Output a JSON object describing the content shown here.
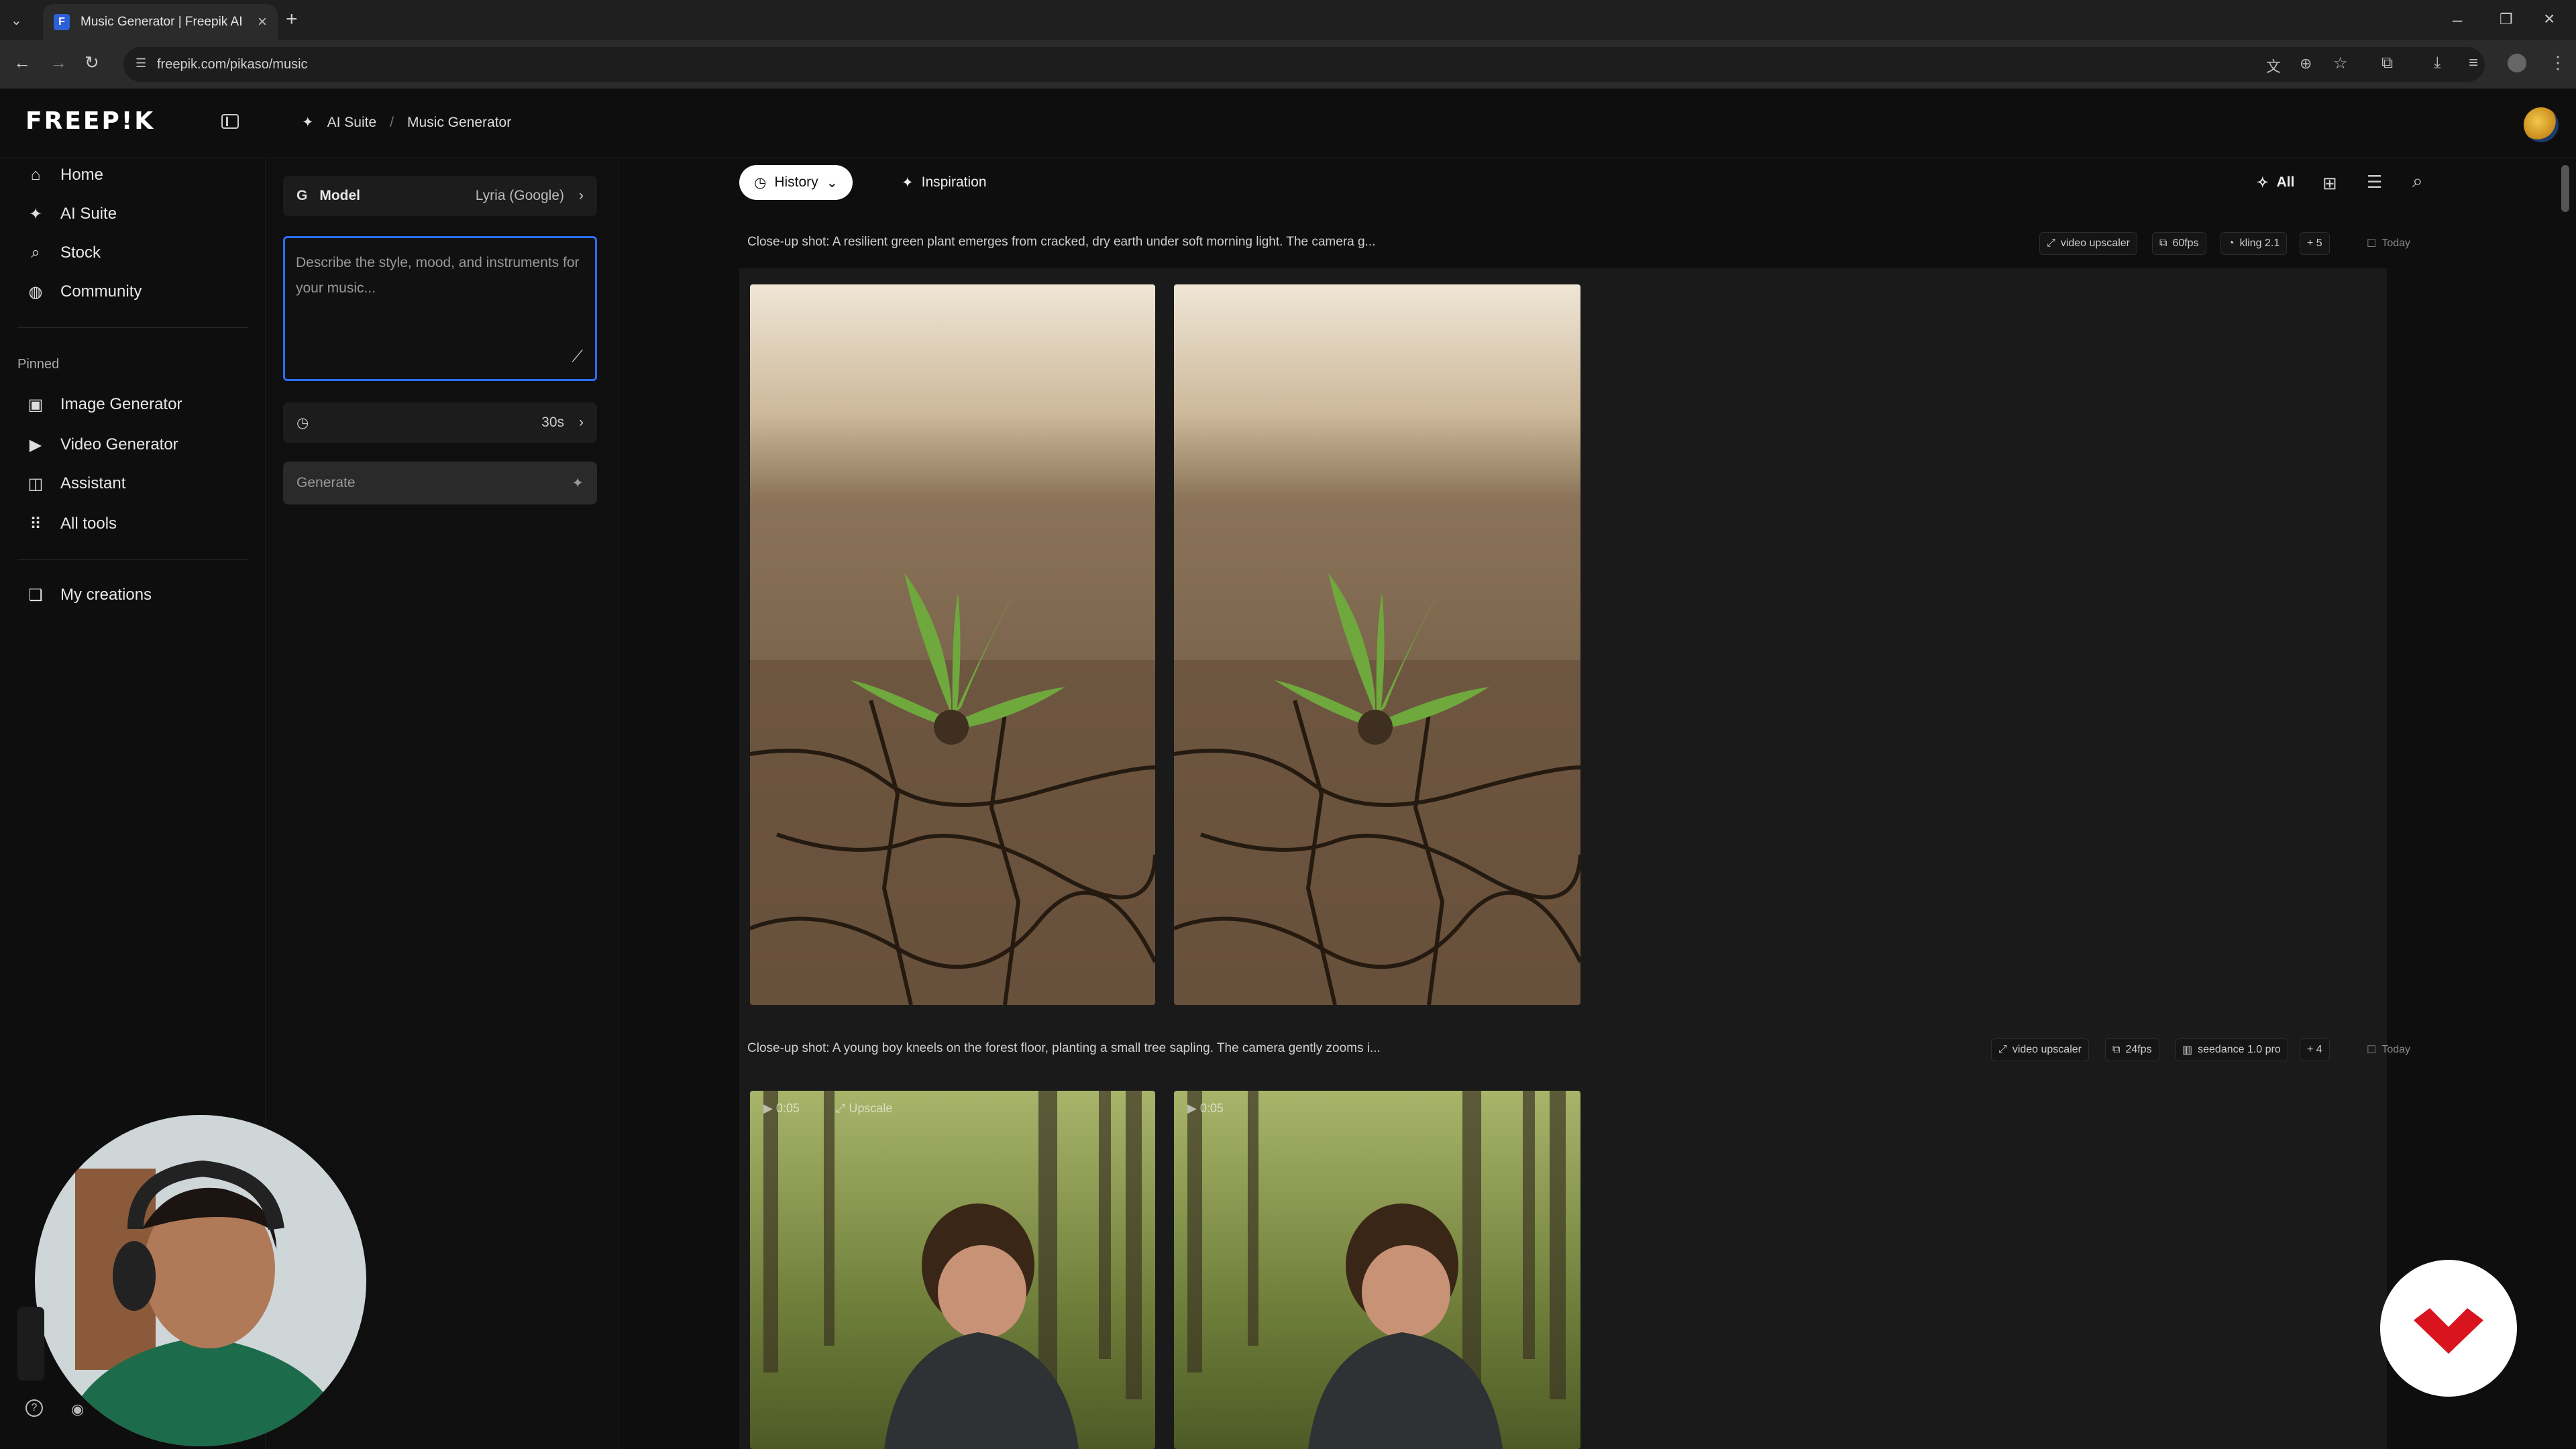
{
  "browser": {
    "tab_title": "Music Generator | Freepik AI",
    "url": "freepik.com/pikaso/music"
  },
  "header": {
    "logo": "FREEP!K",
    "breadcrumb": [
      "AI Suite",
      "Music Generator"
    ]
  },
  "sidebar": {
    "items": [
      {
        "label": "Home",
        "icon": "home-icon"
      },
      {
        "label": "AI Suite",
        "icon": "sparkle-icon"
      },
      {
        "label": "Stock",
        "icon": "search-icon"
      },
      {
        "label": "Community",
        "icon": "globe-icon"
      }
    ],
    "pinned_label": "Pinned",
    "pinned": [
      {
        "label": "Image Generator",
        "icon": "image-icon"
      },
      {
        "label": "Video Generator",
        "icon": "video-icon"
      },
      {
        "label": "Assistant",
        "icon": "chat-icon"
      },
      {
        "label": "All tools",
        "icon": "grid-icon"
      }
    ],
    "my_creations": "My creations"
  },
  "panel": {
    "model_label": "Model",
    "model_value": "Lyria (Google)",
    "prompt_placeholder": "Describe the style, mood, and instruments for your music...",
    "duration": "30s",
    "generate_label": "Generate"
  },
  "main": {
    "tabs": {
      "history": "History",
      "inspiration": "Inspiration"
    },
    "filter_all": "All",
    "rows": [
      {
        "caption": "Close-up shot: A resilient green plant emerges from cracked, dry earth under soft morning light. The camera g...",
        "tags": [
          "video upscaler",
          "60fps",
          "kling 2.1",
          "+ 5"
        ],
        "date": "Today"
      },
      {
        "caption": "Close-up shot: A young boy kneels on the forest floor, planting a small tree sapling. The camera gently zooms i...",
        "tags": [
          "video upscaler",
          "24fps",
          "seedance 1.0 pro",
          "+ 4"
        ],
        "date": "Today",
        "overlay_duration": "0:05",
        "overlay_upscale": "Upscale",
        "overlay_duration_2": "0:05"
      }
    ]
  },
  "colors": {
    "accent": "#2a6ef5",
    "badge_red": "#d9141e"
  }
}
